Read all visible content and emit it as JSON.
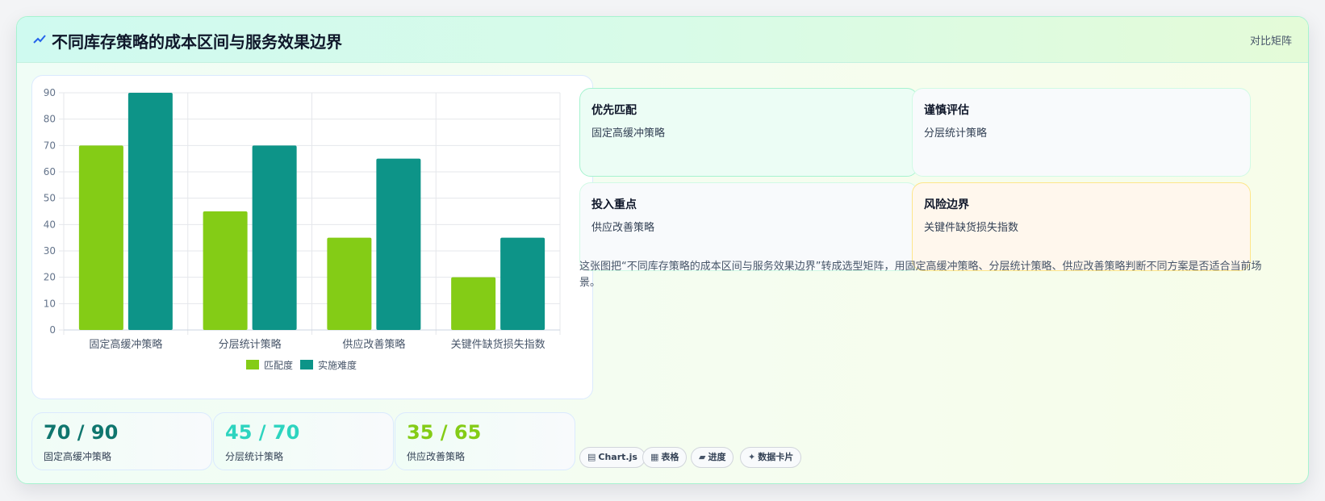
{
  "header": {
    "title": "不同库存策略的成本区间与服务效果边界",
    "tag": "对比矩阵"
  },
  "chart_data": {
    "type": "bar",
    "categories": [
      "固定高缓冲策略",
      "分层统计策略",
      "供应改善策略",
      "关键件缺货损失指数"
    ],
    "series": [
      {
        "name": "匹配度",
        "values": [
          70,
          45,
          35,
          20
        ],
        "color": "#84cc16"
      },
      {
        "name": "实施难度",
        "values": [
          90,
          70,
          65,
          35
        ],
        "color": "#0d9488"
      }
    ],
    "ylim": [
      0,
      90
    ],
    "yticks": [
      0,
      10,
      20,
      30,
      40,
      50,
      60,
      70,
      80,
      90
    ],
    "grid": true,
    "legend": "bottom"
  },
  "stats": [
    {
      "value": "70 / 90",
      "label": "固定高缓冲策略",
      "color": "#0f766e"
    },
    {
      "value": "45 / 70",
      "label": "分层统计策略",
      "color": "#2dd4bf"
    },
    {
      "value": "35 / 65",
      "label": "供应改善策略",
      "color": "#84cc16"
    }
  ],
  "tiles": [
    {
      "title": "优先匹配",
      "desc": "固定高缓冲策略"
    },
    {
      "title": "谨慎评估",
      "desc": "分层统计策略"
    },
    {
      "title": "投入重点",
      "desc": "供应改善策略"
    },
    {
      "title": "风险边界",
      "desc": "关键件缺货损失指数"
    }
  ],
  "description": "这张图把“不同库存策略的成本区间与服务效果边界”转成选型矩阵，用固定高缓冲策略、分层统计策略、供应改善策略判断不同方案是否适合当前场景。",
  "chips": [
    {
      "icon": "chart-icon",
      "glyph": "▤",
      "label": "Chart.js"
    },
    {
      "icon": "table-icon",
      "glyph": "▦",
      "label": "表格"
    },
    {
      "icon": "progress-icon",
      "glyph": "▰",
      "label": "进度"
    },
    {
      "icon": "sparkle-icon",
      "glyph": "✦",
      "label": "数据卡片"
    }
  ]
}
